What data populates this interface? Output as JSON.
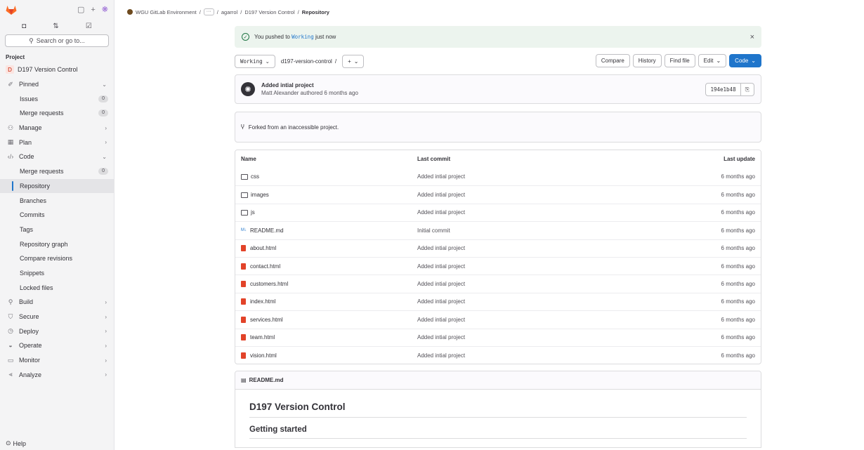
{
  "sidebar": {
    "search_label": "Search or go to...",
    "section_label": "Project",
    "project_name": "D197 Version Control",
    "project_initial": "D",
    "items": [
      {
        "label": "Pinned",
        "type": "group"
      },
      {
        "label": "Issues",
        "type": "sub",
        "badge": "0"
      },
      {
        "label": "Merge requests",
        "type": "sub",
        "badge": "0"
      },
      {
        "label": "Manage",
        "type": "group"
      },
      {
        "label": "Plan",
        "type": "group"
      },
      {
        "label": "Code",
        "type": "group"
      },
      {
        "label": "Merge requests",
        "type": "sub",
        "badge": "0"
      },
      {
        "label": "Repository",
        "type": "sub",
        "active": true
      },
      {
        "label": "Branches",
        "type": "sub"
      },
      {
        "label": "Commits",
        "type": "sub"
      },
      {
        "label": "Tags",
        "type": "sub"
      },
      {
        "label": "Repository graph",
        "type": "sub"
      },
      {
        "label": "Compare revisions",
        "type": "sub"
      },
      {
        "label": "Snippets",
        "type": "sub"
      },
      {
        "label": "Locked files",
        "type": "sub"
      },
      {
        "label": "Build",
        "type": "group"
      },
      {
        "label": "Secure",
        "type": "group"
      },
      {
        "label": "Deploy",
        "type": "group"
      },
      {
        "label": "Operate",
        "type": "group"
      },
      {
        "label": "Monitor",
        "type": "group"
      },
      {
        "label": "Analyze",
        "type": "group"
      }
    ],
    "help_label": "Help"
  },
  "breadcrumb": {
    "org": "WGU GitLab Environment",
    "ellipsis": "···",
    "user": "agarrol",
    "project": "D197 Version Control",
    "current": "Repository"
  },
  "alert": {
    "prefix": "You pushed to",
    "branch": "Working",
    "suffix": "just now"
  },
  "toolbar": {
    "branch": "Working",
    "path": "d197-version-control",
    "path_sep": "/",
    "add": "+",
    "compare": "Compare",
    "history": "History",
    "find_file": "Find file",
    "edit": "Edit",
    "code": "Code"
  },
  "commit": {
    "title": "Added intial project",
    "author": "Matt Alexander",
    "meta_rest": "authored 6 months ago",
    "sha": "194e1b48"
  },
  "forked_message": "Forked from an inaccessible project.",
  "files": {
    "headers": {
      "name": "Name",
      "last_commit": "Last commit",
      "last_update": "Last update"
    },
    "rows": [
      {
        "name": "css",
        "type": "folder",
        "commit": "Added intial project",
        "updated": "6 months ago"
      },
      {
        "name": "images",
        "type": "folder",
        "commit": "Added intial project",
        "updated": "6 months ago"
      },
      {
        "name": "js",
        "type": "folder",
        "commit": "Added intial project",
        "updated": "6 months ago"
      },
      {
        "name": "README.md",
        "type": "md",
        "commit": "Initial commit",
        "updated": "6 months ago"
      },
      {
        "name": "about.html",
        "type": "html",
        "commit": "Added intial project",
        "updated": "6 months ago"
      },
      {
        "name": "contact.html",
        "type": "html",
        "commit": "Added intial project",
        "updated": "6 months ago"
      },
      {
        "name": "customers.html",
        "type": "html",
        "commit": "Added intial project",
        "updated": "6 months ago"
      },
      {
        "name": "index.html",
        "type": "html",
        "commit": "Added intial project",
        "updated": "6 months ago"
      },
      {
        "name": "services.html",
        "type": "html",
        "commit": "Added intial project",
        "updated": "6 months ago"
      },
      {
        "name": "team.html",
        "type": "html",
        "commit": "Added intial project",
        "updated": "6 months ago"
      },
      {
        "name": "vision.html",
        "type": "html",
        "commit": "Added intial project",
        "updated": "6 months ago"
      }
    ]
  },
  "readme": {
    "filename": "README.md",
    "h1": "D197 Version Control",
    "h2": "Getting started"
  },
  "colors": {
    "primary": "#1f75cb",
    "success_bg": "#ecf4ee",
    "html_icon": "#e24329",
    "gitlab_orange": "#fc6d26"
  }
}
